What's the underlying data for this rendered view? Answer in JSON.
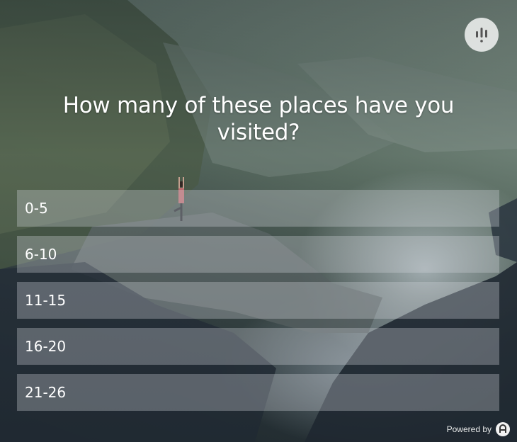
{
  "poll": {
    "question": "How many of these places have you visited?",
    "options": [
      "0-5",
      "6-10",
      "11-15",
      "16-20",
      "21-26"
    ]
  },
  "footer": {
    "powered_by": "Powered by"
  },
  "icons": {
    "top_right": "poll-logo-icon",
    "footer": "brand-logo-icon"
  },
  "colors": {
    "option_bg": "rgba(210,215,220,0.32)",
    "text": "#ffffff"
  }
}
